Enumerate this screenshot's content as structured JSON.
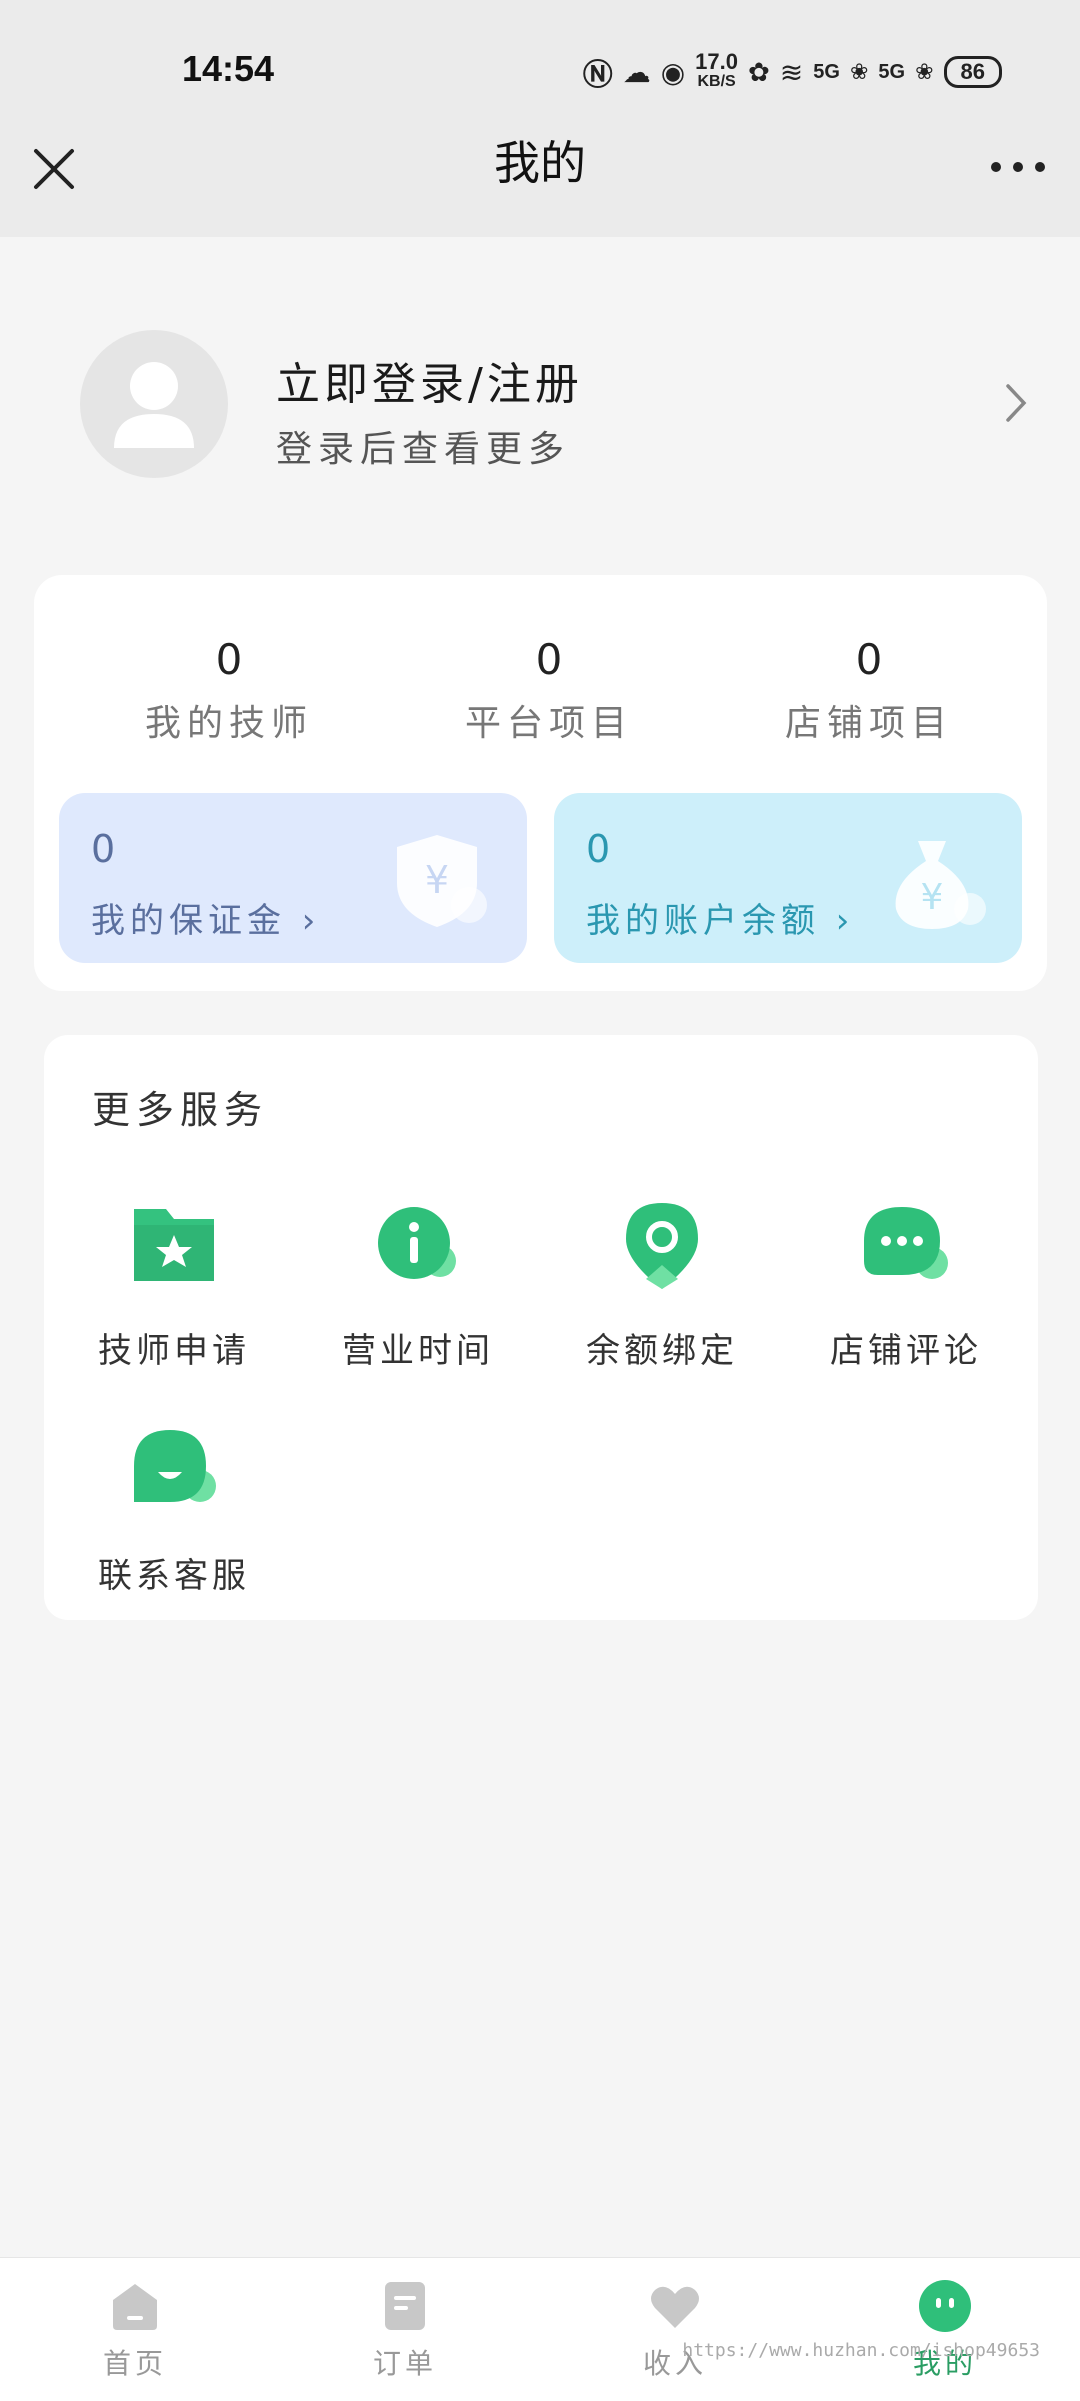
{
  "status_bar": {
    "time": "14:54",
    "net_speed_value": "17.0",
    "net_speed_unit": "KB/S",
    "signal_1": "5G",
    "signal_2": "5G",
    "battery": "86"
  },
  "nav": {
    "title": "我的"
  },
  "profile": {
    "title": "立即登录/注册",
    "subtitle": "登录后查看更多"
  },
  "stats": [
    {
      "value": "0",
      "label": "我的技师"
    },
    {
      "value": "0",
      "label": "平台项目"
    },
    {
      "value": "0",
      "label": "店铺项目"
    }
  ],
  "money": [
    {
      "value": "0",
      "label": "我的保证金 ›",
      "color": "#5a6f9e",
      "bg": "#dfe9fd"
    },
    {
      "value": "0",
      "label": "我的账户余额 ›",
      "color": "#2a97b0",
      "bg": "#cdeffa"
    }
  ],
  "services": {
    "title": "更多服务",
    "items": [
      {
        "label": "技师申请",
        "icon": "star-folder-icon"
      },
      {
        "label": "营业时间",
        "icon": "info-icon"
      },
      {
        "label": "余额绑定",
        "icon": "location-pin-icon"
      },
      {
        "label": "店铺评论",
        "icon": "chat-bubble-icon"
      },
      {
        "label": "联系客服",
        "icon": "customer-service-icon"
      }
    ]
  },
  "tabs": [
    {
      "label": "首页",
      "icon": "home-icon"
    },
    {
      "label": "订单",
      "icon": "order-icon"
    },
    {
      "label": "收入",
      "icon": "heart-icon"
    },
    {
      "label": "我的",
      "icon": "profile-face-icon",
      "active": true
    }
  ],
  "watermark": "https://www.huzhan.com/ishop49653",
  "colors": {
    "accent": "#2fbf7a",
    "background": "#f5f5f5"
  }
}
